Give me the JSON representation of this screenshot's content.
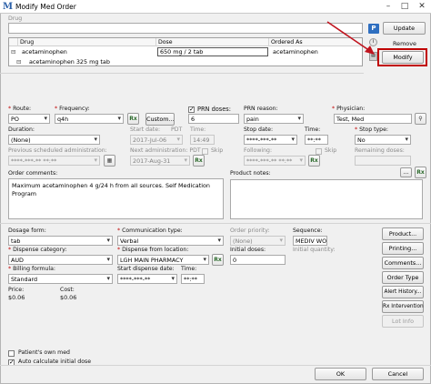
{
  "window": {
    "title": "Modify Med Order",
    "icon_letter": "M",
    "minimize": "–",
    "maximize": "□",
    "close": "✕"
  },
  "drug_search": {
    "label": "Drug",
    "p_badge": "P"
  },
  "actions": {
    "update": "Update",
    "remove": "Remove",
    "modify": "Modify"
  },
  "grid": {
    "columns": [
      "Drug",
      "Dose",
      "Ordered As"
    ],
    "rows": [
      {
        "drug": "acetaminophen",
        "dose": "650 mg / 2 tab",
        "ordered_as": "acetaminophen"
      },
      {
        "drug": "acetaminophen 325 mg tab",
        "dose": "",
        "ordered_as": ""
      }
    ]
  },
  "form": {
    "route_label": "Route:",
    "route_value": "PO",
    "frequency_label": "Frequency:",
    "frequency_value": "q4h",
    "custom_button": "Custom...",
    "prn_doses_label": "PRN doses:",
    "prn_doses_value": "6",
    "prn_reason_label": "PRN reason:",
    "prn_reason_value": "pain",
    "physician_label": "Physician:",
    "physician_value": "Test, Med",
    "duration_label": "Duration:",
    "duration_value": "(None)",
    "start_date_label": "Start date:",
    "start_date_value": "2017-Jul-06",
    "start_time_label": "Time:",
    "start_time_value": "14:49",
    "stop_date_label": "Stop date:",
    "stop_date_value": "****-***-**",
    "stop_time_label": "Time:",
    "stop_time_value": "**:**",
    "stop_type_label": "Stop type:",
    "stop_type_value": "No",
    "prev_admin_label": "Previous scheduled administration:",
    "prev_admin_value": "****-***-** **:**",
    "next_admin_label": "Next administration: PDT",
    "next_admin_value": "2017-Aug-31",
    "skip_label": "Skip",
    "following_label": "Following:",
    "following_value": "****-***-** **:**",
    "remaining_doses_label": "Remaining doses:",
    "order_comments_label": "Order comments:",
    "order_comments_value": "Maximum acetaminophen 4 g/24 h from all sources.  Self Medication Program",
    "product_notes_label": "Product notes:",
    "ellipsis": "...",
    "dosage_form_label": "Dosage form:",
    "dosage_form_value": "tab",
    "communication_type_label": "Communication type:",
    "communication_type_value": "Verbal",
    "order_priority_label": "Order priority:",
    "order_priority_value": "(None)",
    "sequence_label": "Sequence:",
    "sequence_value": "MEDIV WO",
    "dispense_category_label": "Dispense category:",
    "dispense_category_value": "AUD",
    "dispense_from_label": "Dispense from location:",
    "dispense_from_value": "LGH MAIN PHARMACY",
    "initial_doses_label": "Initial doses:",
    "initial_doses_value": "0",
    "initial_quantity_label": "Initial quantity:",
    "billing_formula_label": "Billing formula:",
    "billing_formula_value": "Standard",
    "start_dispense_label": "Start dispense date:",
    "start_dispense_value": "****-***-**",
    "dispense_time_label": "Time:",
    "dispense_time_value": "**:**",
    "price_label": "Price:",
    "price_value": "$0.06",
    "cost_label": "Cost:",
    "cost_value": "$0.06",
    "patients_own_med_label": "Patient's own med",
    "auto_calc_label": "Auto calculate initial dose",
    "time_zone_pdt": "PDT"
  },
  "side_buttons": [
    "Product...",
    "Printing...",
    "Comments...",
    "Order Type",
    "Alert History...",
    "Rx Intervention",
    "Lot Info"
  ],
  "footer": {
    "ok": "OK",
    "cancel": "Cancel"
  },
  "colors": {
    "highlight_red": "#c00000",
    "arrow_red": "#c0141e"
  },
  "icons": {
    "rx_button": "Rx",
    "search": "magnifier-icon",
    "calendar": "calendar-icon"
  }
}
